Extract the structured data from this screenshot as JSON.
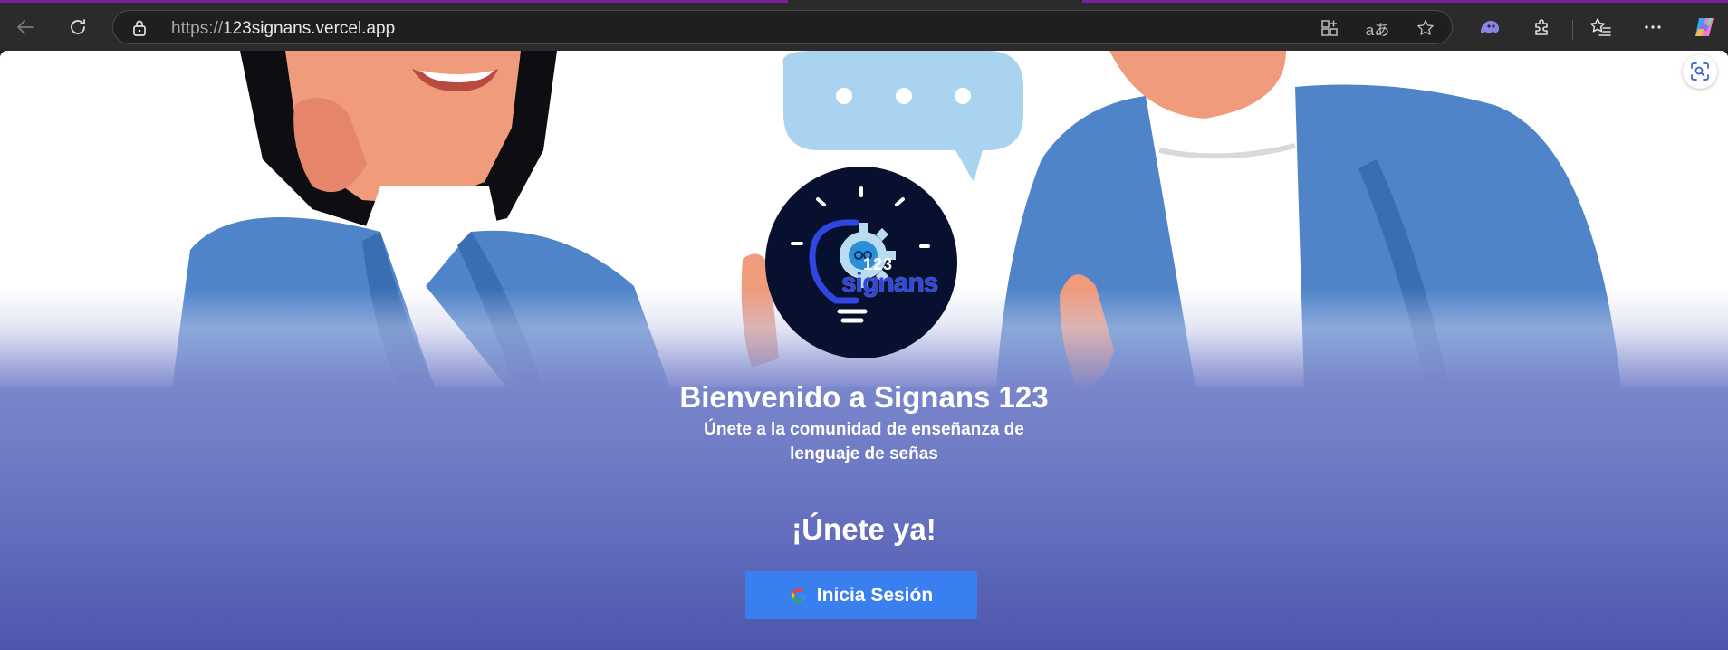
{
  "browser": {
    "url_protocol": "https://",
    "url_host": "123signans.vercel.app",
    "icons": {
      "back": "back-arrow-icon",
      "refresh": "refresh-icon",
      "lock": "lock-icon",
      "app_available": "app-available-icon",
      "read_aloud": "translate-icon",
      "favorite": "star-icon",
      "copilot_ext": "ghost-extension-icon",
      "extensions": "puzzle-icon",
      "favorites": "favorites-icon",
      "more": "more-icon",
      "copilot": "copilot-icon"
    }
  },
  "hero": {
    "logo_number": "123",
    "logo_word": "signans"
  },
  "welcome": {
    "title": "Bienvenido a Signans 123",
    "subtitle": "Únete a la comunidad de enseñanza de lenguaje de señas",
    "cta_heading": "¡Únete ya!",
    "signin_label": "Inicia Sesión"
  },
  "colors": {
    "accent_button": "#3a7ff0",
    "logo_background": "#081030",
    "logo_blue": "#2f47e0",
    "lower_gradient_top": "#7a86cb",
    "lower_gradient_bottom": "#4d56ab"
  }
}
